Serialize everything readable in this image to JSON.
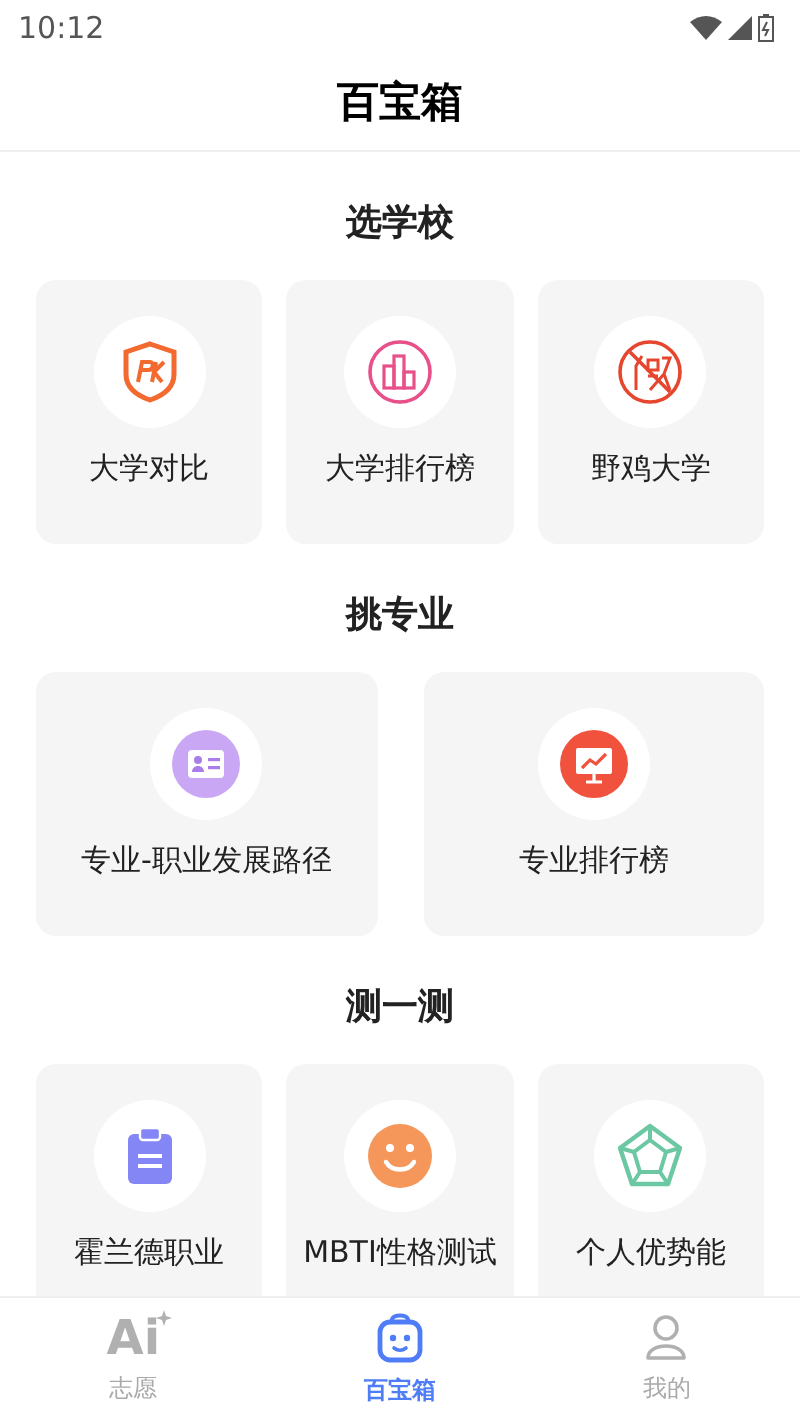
{
  "status_bar": {
    "time": "10:12"
  },
  "header": {
    "title": "百宝箱"
  },
  "sections": [
    {
      "title": "选学校",
      "items": [
        {
          "label": "大学对比",
          "kind": "pk-shield"
        },
        {
          "label": "大学排行榜",
          "kind": "bars"
        },
        {
          "label": "野鸡大学",
          "kind": "fake"
        }
      ]
    },
    {
      "title": "挑专业",
      "items": [
        {
          "label": "专业-职业发展路径",
          "kind": "id-card"
        },
        {
          "label": "专业排行榜",
          "kind": "board"
        }
      ]
    },
    {
      "title": "测一测",
      "items": [
        {
          "label": "霍兰德职业",
          "kind": "clipboard"
        },
        {
          "label": "MBTI性格测试",
          "kind": "smile"
        },
        {
          "label": "个人优势能",
          "kind": "pentagon"
        }
      ]
    }
  ],
  "tab_bar": [
    {
      "label": "志愿",
      "icon_text": "Ai",
      "kind": "ai",
      "selected": false
    },
    {
      "label": "百宝箱",
      "kind": "robot",
      "selected": true
    },
    {
      "label": "我的",
      "kind": "person",
      "selected": false
    }
  ]
}
